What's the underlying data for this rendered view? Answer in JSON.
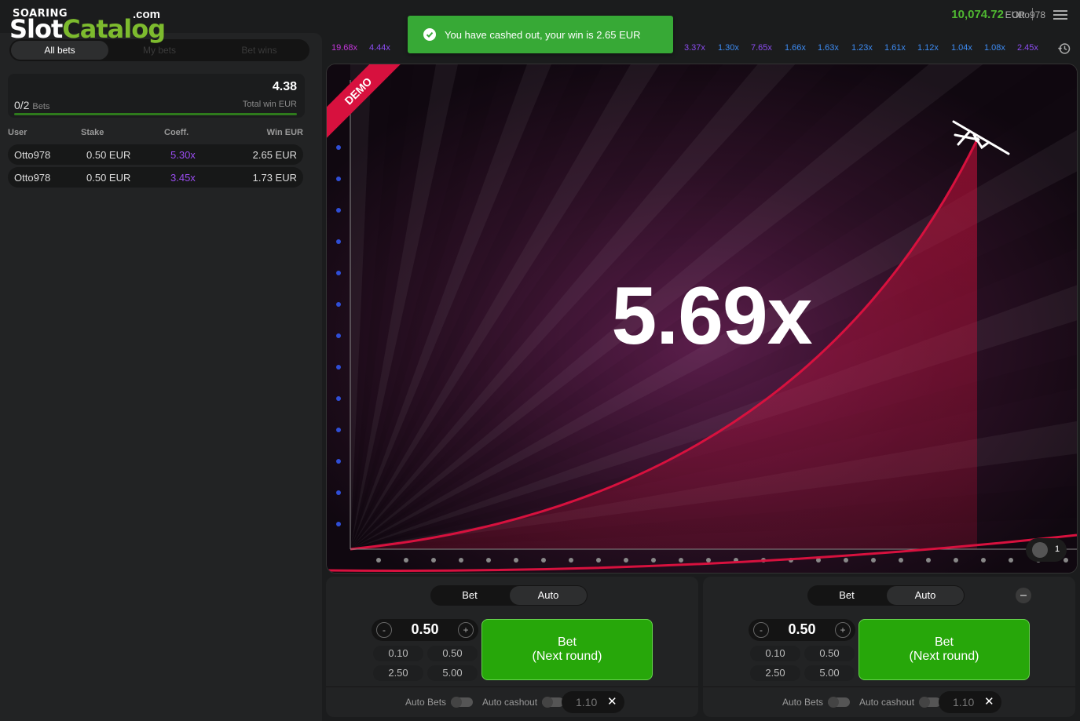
{
  "brand": {
    "line1": "SOARING",
    "slot": "Slot",
    "catalog": "Catalog",
    "com": ".com"
  },
  "header": {
    "balance": "10,074.72",
    "currency": "EUR",
    "username": "Otto978"
  },
  "toast": {
    "message": "You have cashed out, your win is 2.65 EUR"
  },
  "sidebar": {
    "tabs": [
      "All bets",
      "My bets",
      "Bet wins"
    ],
    "summary": {
      "count": "0/2",
      "count_label": "Bets",
      "total_win": "4.38",
      "total_label": "Total win EUR"
    },
    "columns": [
      "User",
      "Stake",
      "Coeff.",
      "Win EUR"
    ],
    "rows": [
      {
        "user": "Otto978",
        "stake": "0.50 EUR",
        "coeff": "5.30x",
        "win": "2.65 EUR"
      },
      {
        "user": "Otto978",
        "stake": "0.50 EUR",
        "coeff": "3.45x",
        "win": "1.73 EUR"
      }
    ]
  },
  "history": [
    {
      "value": "19.68x",
      "color": "#c236d9"
    },
    {
      "value": "4.44x",
      "color": "#8b4cf0"
    },
    {
      "value": "3.37x",
      "color": "#8b4cf0"
    },
    {
      "value": "1.30x",
      "color": "#3d8bf2"
    },
    {
      "value": "7.65x",
      "color": "#8b4cf0"
    },
    {
      "value": "1.66x",
      "color": "#3d8bf2"
    },
    {
      "value": "1.63x",
      "color": "#3d8bf2"
    },
    {
      "value": "1.23x",
      "color": "#3d8bf2"
    },
    {
      "value": "1.61x",
      "color": "#3d8bf2"
    },
    {
      "value": "1.12x",
      "color": "#3d8bf2"
    },
    {
      "value": "1.04x",
      "color": "#3d8bf2"
    },
    {
      "value": "1.08x",
      "color": "#3d8bf2"
    },
    {
      "value": "2.45x",
      "color": "#8b4cf0"
    }
  ],
  "game": {
    "multiplier": "5.69x",
    "demo_label": "DEMO",
    "players_count": "1"
  },
  "panels": [
    {
      "tabs": [
        "Bet",
        "Auto"
      ],
      "stake": "0.50",
      "quick": [
        "0.10",
        "0.50",
        "2.50",
        "5.00"
      ],
      "bet_label": "Bet",
      "bet_sub": "(Next round)",
      "auto_bets_label": "Auto Bets",
      "auto_cashout_label": "Auto cashout",
      "auto_cashout_value": "1.10"
    },
    {
      "tabs": [
        "Bet",
        "Auto"
      ],
      "stake": "0.50",
      "quick": [
        "0.10",
        "0.50",
        "2.50",
        "5.00"
      ],
      "bet_label": "Bet",
      "bet_sub": "(Next round)",
      "auto_bets_label": "Auto Bets",
      "auto_cashout_label": "Auto cashout",
      "auto_cashout_value": "1.10"
    }
  ],
  "colors": {
    "accent_green": "#27a70a",
    "balance_green": "#4fb831",
    "curve": "#d7113e"
  }
}
